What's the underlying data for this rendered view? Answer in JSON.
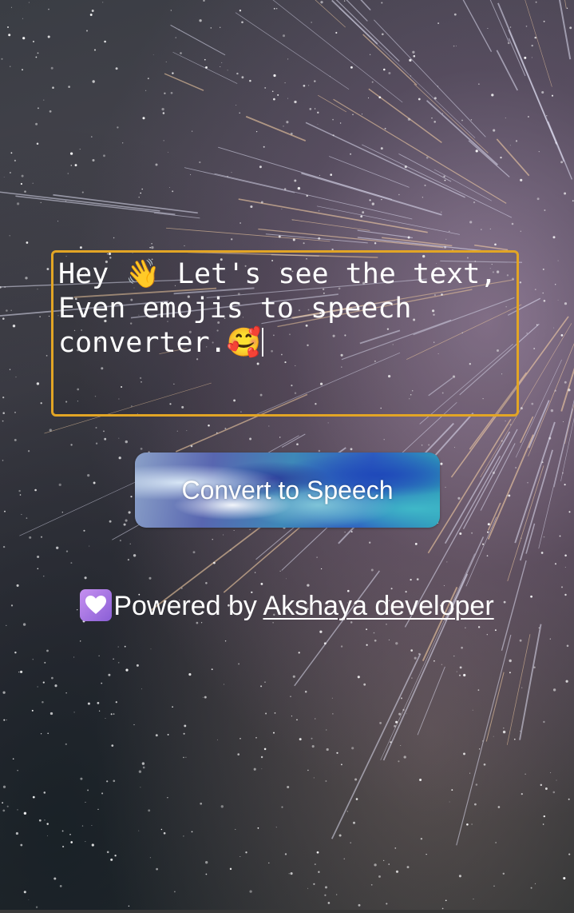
{
  "input": {
    "value": "Hey 👋 Let's see the text, Even emojis to speech converter.🥰",
    "border_color": "#e2a525"
  },
  "convert_button": {
    "label": "Convert to Speech"
  },
  "footer": {
    "icon": "heart-icon",
    "prefix": "Powered by ",
    "link_text": "Akshaya developer"
  }
}
